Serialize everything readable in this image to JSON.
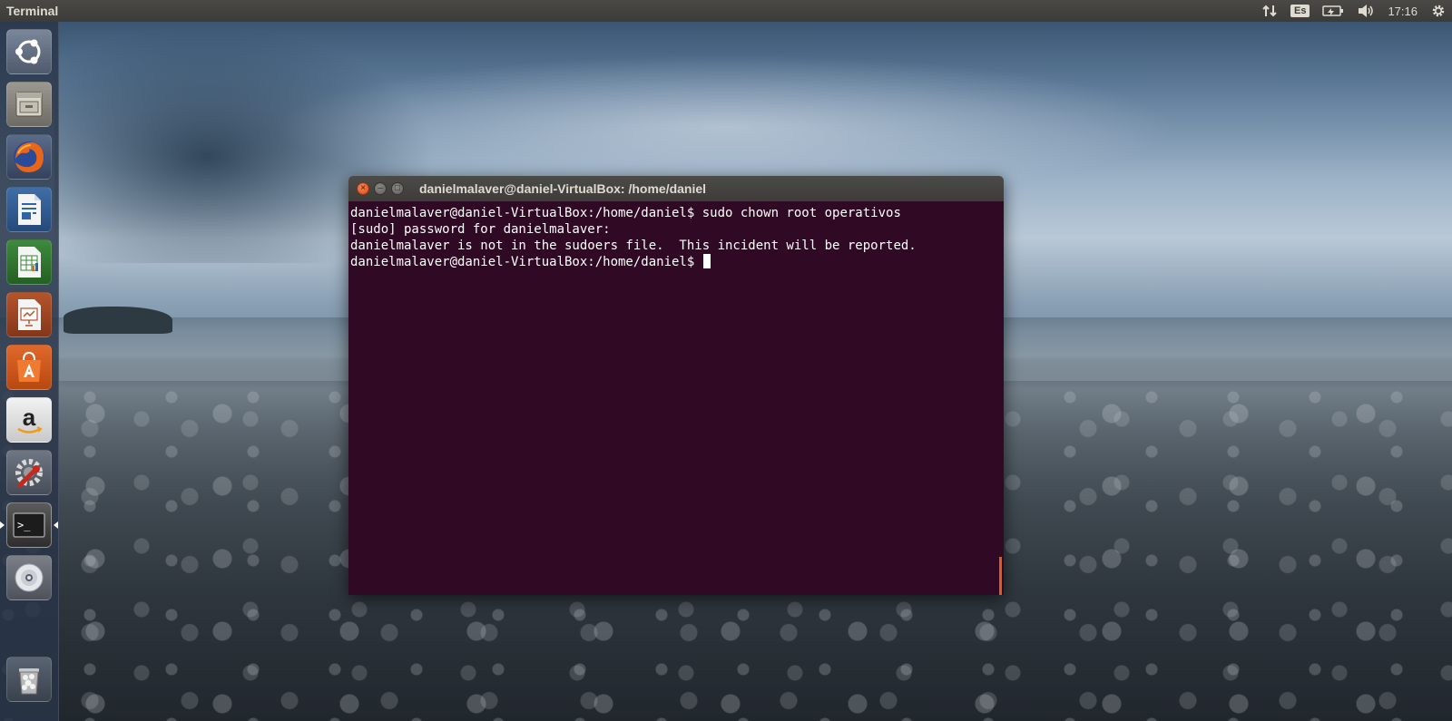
{
  "top_panel": {
    "app_title": "Terminal",
    "keyboard_layout": "Es",
    "clock": "17:16",
    "icons": [
      "network-arrows-icon",
      "keyboard-layout-icon",
      "battery-icon",
      "volume-icon",
      "gear-icon"
    ]
  },
  "launcher": {
    "items": [
      {
        "name": "dash-home",
        "icon": "ubuntu-logo-icon"
      },
      {
        "name": "files",
        "icon": "file-cabinet-icon"
      },
      {
        "name": "firefox",
        "icon": "firefox-icon"
      },
      {
        "name": "libreoffice-writer",
        "icon": "writer-icon"
      },
      {
        "name": "libreoffice-calc",
        "icon": "calc-icon"
      },
      {
        "name": "libreoffice-impress",
        "icon": "impress-icon"
      },
      {
        "name": "software-center",
        "icon": "shopping-bag-icon"
      },
      {
        "name": "amazon",
        "icon": "amazon-icon"
      },
      {
        "name": "system-settings",
        "icon": "settings-wrench-icon"
      },
      {
        "name": "terminal",
        "icon": "terminal-icon",
        "active": true
      },
      {
        "name": "dvd",
        "icon": "disc-icon"
      },
      {
        "name": "trash",
        "icon": "trash-icon"
      }
    ],
    "amazon_glyph": "a",
    "terminal_glyph": ">_"
  },
  "terminal": {
    "window_title": "danielmalaver@daniel-VirtualBox: /home/daniel",
    "buttons": {
      "close": "×",
      "minimize": "–",
      "maximize": "□"
    },
    "lines": [
      "danielmalaver@daniel-VirtualBox:/home/daniel$ sudo chown root operativos",
      "[sudo] password for danielmalaver:",
      "danielmalaver is not in the sudoers file.  This incident will be reported.",
      "danielmalaver@daniel-VirtualBox:/home/daniel$ "
    ]
  },
  "colors": {
    "panel_bg": "#3c3b37",
    "terminal_bg": "#300a24",
    "accent_orange": "#e05c1c",
    "text_light": "#dfdbd2"
  }
}
